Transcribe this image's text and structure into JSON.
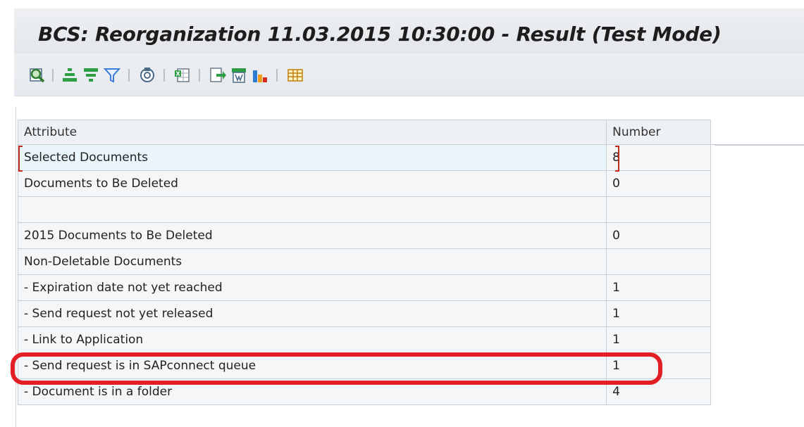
{
  "header": {
    "title": "BCS: Reorganization 11.03.2015 10:30:00 - Result (Test Mode)"
  },
  "toolbar": {
    "icons": [
      "details-icon",
      "sort-ascending-icon",
      "sort-descending-icon",
      "filter-icon",
      "total-icon",
      "export-spreadsheet-icon",
      "export-local-file-icon",
      "word-processing-icon",
      "graphic-icon",
      "change-layout-icon"
    ]
  },
  "table": {
    "columns": [
      "Attribute",
      "Number"
    ],
    "rows": [
      {
        "attribute": "Selected Documents",
        "number": "8"
      },
      {
        "attribute": "Documents to Be Deleted",
        "number": "0"
      },
      {
        "attribute": "",
        "number": ""
      },
      {
        "attribute": "2015 Documents to Be Deleted",
        "number": "0"
      },
      {
        "attribute": "Non-Deletable Documents",
        "number": ""
      },
      {
        "attribute": "- Expiration date not yet reached",
        "number": "1"
      },
      {
        "attribute": "- Send request not yet released",
        "number": "1"
      },
      {
        "attribute": "- Link to Application",
        "number": "1"
      },
      {
        "attribute": "- Send request is in SAPconnect queue",
        "number": "1"
      },
      {
        "attribute": "- Document is in a folder",
        "number": "4"
      }
    ]
  },
  "colors": {
    "highlight": "#e21f25",
    "selection_bracket": "#c12a1a",
    "selected_row": "#e9f5fb"
  }
}
